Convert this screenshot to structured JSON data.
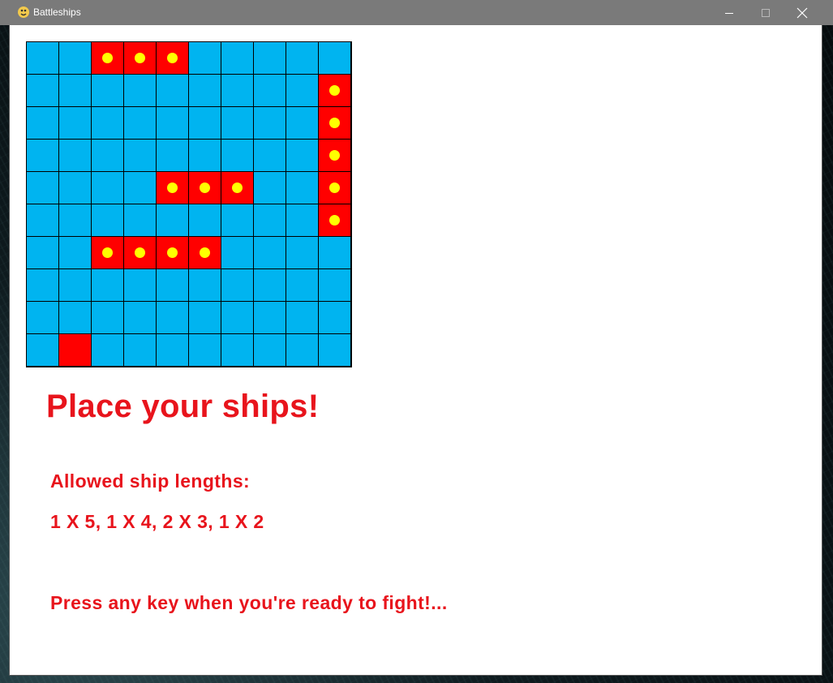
{
  "window": {
    "title": "Battleships",
    "icon": "python-snake-icon",
    "controls": [
      "minimize-icon",
      "maximize-icon",
      "close-icon"
    ]
  },
  "board": {
    "rows": 10,
    "cols": 10,
    "water_color": "#00b4f0",
    "ship_color": "#ff0000",
    "peg_color": "#ffff00",
    "grid": [
      "..SSS.....",
      ".........S",
      ".........S",
      ".........S",
      "....SSS..S",
      ".........S",
      "..SSSS....",
      "..........",
      "..........",
      ".C........"
    ],
    "legend": {
      "S": "ship segment with yellow peg",
      "C": "cursor cell (red, no peg)",
      ".": "water"
    }
  },
  "text": {
    "heading": "Place your ships!",
    "allowed_label": "Allowed ship lengths:",
    "allowed_values": "1 X 5, 1 X 4, 2 X 3, 1 X 2",
    "prompt": "Press any key when you're ready to fight!..."
  },
  "colors": {
    "titlebar": "#7a7a7a",
    "text": "#e8141c",
    "background": "#ffffff"
  }
}
